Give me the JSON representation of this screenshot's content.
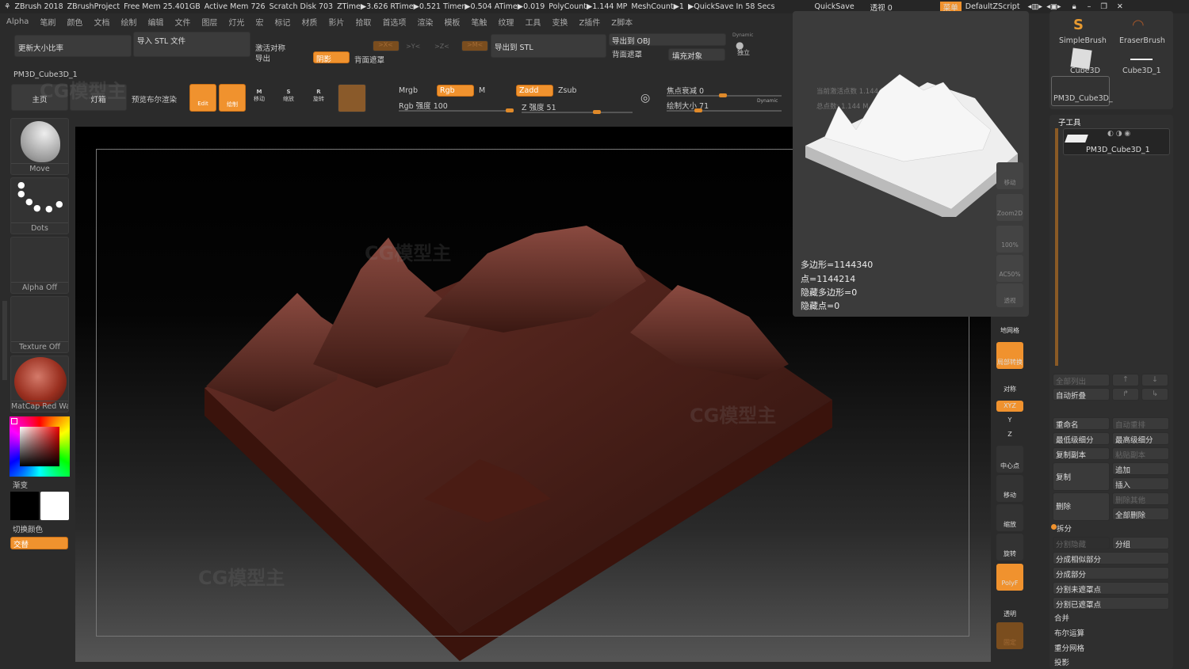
{
  "topbar": {
    "app": "ZBrush 2018",
    "project": "ZBrushProject",
    "free_mem": "Free Mem 25.401GB",
    "active_mem": "Active Mem 726",
    "scratch": "Scratch Disk 703",
    "ztime": "ZTime▶3.626 RTime▶0.521 Timer▶0.504 ATime▶0.019",
    "polycount": "PolyCount▶1.144 MP",
    "meshcount": "MeshCount▶1",
    "quicksave_timer": "▶QuickSave In 58 Secs",
    "quicksave": "QuickSave",
    "transparency": "透视  0",
    "menu": "菜单",
    "script": "DefaultZScript"
  },
  "menubar": [
    "Alpha",
    "笔刷",
    "颜色",
    "文档",
    "绘制",
    "编辑",
    "文件",
    "图层",
    "灯光",
    "宏",
    "标记",
    "材质",
    "影片",
    "拾取",
    "首选项",
    "渲染",
    "模板",
    "笔触",
    "纹理",
    "工具",
    "变换",
    "Z插件",
    "Z脚本"
  ],
  "palette": {
    "resize": "更新大小比率",
    "import_stl": "导入 STL 文件",
    "activate_sym": "激活对称",
    "export": "导出",
    "shadow": "阴影",
    "backface": "背面遮罩",
    "x": ">X<",
    "y": ">Y<",
    "z": ">Z<",
    "m": ">M<",
    "export_stl": "导出到 STL",
    "export_obj": "导出到 OBJ",
    "backface2": "背面遮罩",
    "fill": "填充对象",
    "dynamic": "Dynamic",
    "solo": "独立"
  },
  "tool_name": "PM3D_Cube3D_1",
  "toolbar": {
    "home": "主页",
    "lightbox": "灯箱",
    "preview_bool": "预览布尔渲染",
    "edit": "Edit",
    "draw": "绘制",
    "move": "移动",
    "scale": "缩放",
    "rotate": "旋转",
    "mrgb": "Mrgb",
    "rgb": "Rgb",
    "m": "M",
    "zadd": "Zadd",
    "zsub": "Zsub",
    "rgb_intensity": "Rgb 强度 100",
    "z_intensity": "Z 强度 51",
    "focal": "焦点衰减 0",
    "draw_size": "绘制大小 71",
    "dynamic": "Dynamic",
    "rgb_intensity_value": 100,
    "z_intensity_value": 51,
    "draw_size_value": 71
  },
  "shelf": {
    "brush": "Move",
    "stroke": "Dots",
    "alpha": "Alpha Off",
    "texture": "Texture Off",
    "material": "MatCap Red Wax",
    "gradient": "渐变",
    "switch_color": "切换颜色",
    "alternate": "交替"
  },
  "preview": {
    "active_points": "当前激活点数 1.144 M",
    "total_points": "总点数: 1.144 M",
    "polygons": "多边形=1144340",
    "points": "点=1144214",
    "hidden_polys": "隐藏多边形=0",
    "hidden_points": "隐藏点=0"
  },
  "right_toolbar": [
    "移动",
    "Zoom2D",
    "100%",
    "AC50%",
    "透视",
    "地网格",
    "局部转换",
    "对称",
    "XYZ",
    "Y",
    "Z",
    "中心点",
    "移动",
    "缩放",
    "旋转",
    "PolyF",
    "透明",
    "固定"
  ],
  "tools": {
    "items": [
      "SimpleBrush",
      "EraserBrush",
      "Cube3D",
      "Cube3D_1",
      "PM3D_Cube3D_"
    ]
  },
  "subtool": {
    "title": "子工具",
    "item": "PM3D_Cube3D_1",
    "list_all": "全部列出",
    "auto_collapse": "自动折叠",
    "rename": "重命名",
    "auto_reorder": "自动重排",
    "lowest": "最低级细分",
    "highest": "最高级细分",
    "copy": "复制副本",
    "paste": "粘贴副本",
    "duplicate": "复制",
    "append": "追加",
    "insert": "插入",
    "delete": "删除",
    "delete_other": "删除其他",
    "delete_all": "全部删除",
    "split": "拆分",
    "split_hidden": "分割隐藏",
    "groups_split": "分组",
    "split_similar": "分成相似部分",
    "split_parts": "分成部分",
    "split_unmasked": "分割未遮罩点",
    "split_masked": "分割已遮罩点",
    "merge": "合并",
    "boolean": "布尔运算",
    "remesh": "重分网格",
    "project": "投影"
  },
  "colors": {
    "accent": "#f0922e",
    "panel": "#3a3a3a",
    "terrain": "#5a2a22"
  },
  "watermark": "CG模型主"
}
